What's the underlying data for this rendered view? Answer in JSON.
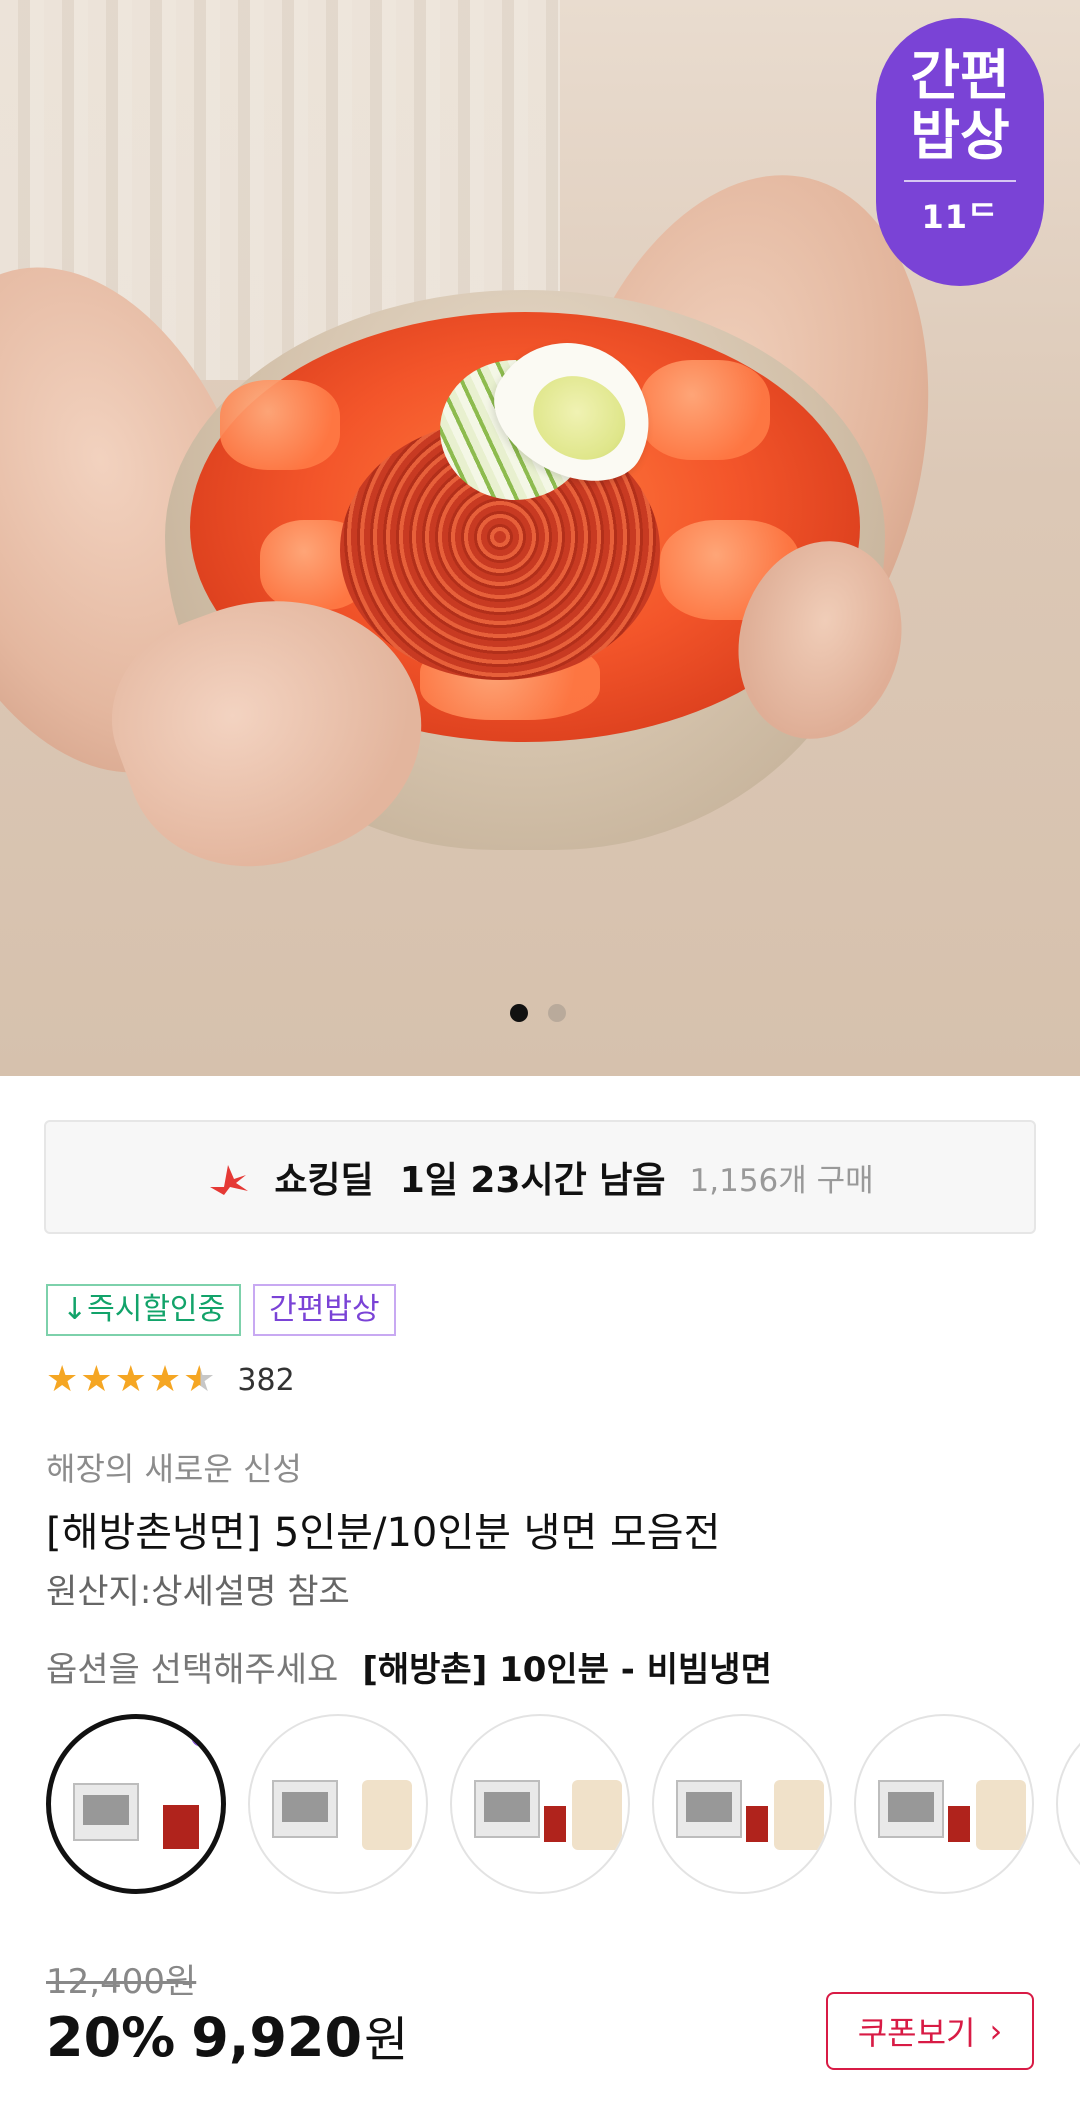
{
  "badge": {
    "line1": "간편",
    "line2": "밥상",
    "logo": "11ᄃ"
  },
  "carousel": {
    "total": 2,
    "active": 1
  },
  "deal": {
    "icon": "shocking-deal-icon",
    "title": "쇼킹딜",
    "time_left": "1일 23시간 남음",
    "purchases": "1,156개 구매"
  },
  "tags": [
    {
      "label": "↓즉시할인중",
      "color": "#12a36a"
    },
    {
      "label": "간편밥상",
      "color": "#7a43d6"
    }
  ],
  "rating": {
    "stars": 4.5,
    "count": "382"
  },
  "product": {
    "subtitle": "해장의 새로운 신성",
    "title": "[해방촌냉면] 5인분/10인분 냉면 모음전",
    "origin": "원산지:상세설명 참조"
  },
  "option": {
    "label": "옵션을 선택해주세요",
    "selected": "[해방촌] 10인분 - 비빔냉면"
  },
  "thumbnails": [
    {
      "name": "option-1",
      "selected": true
    },
    {
      "name": "option-2",
      "selected": false
    },
    {
      "name": "option-3",
      "selected": false
    },
    {
      "name": "option-4",
      "selected": false
    },
    {
      "name": "option-5",
      "selected": false
    },
    {
      "name": "option-6",
      "selected": false
    }
  ],
  "price": {
    "original": "12,400원",
    "discount": "20%",
    "current": "9,920",
    "currency": "원"
  },
  "coupon": {
    "label": "쿠폰보기",
    "icon": "chevron-right-icon"
  },
  "colors": {
    "accent": "#7a43d6",
    "coupon": "#d81b45",
    "deal_icon": "#e53935"
  }
}
